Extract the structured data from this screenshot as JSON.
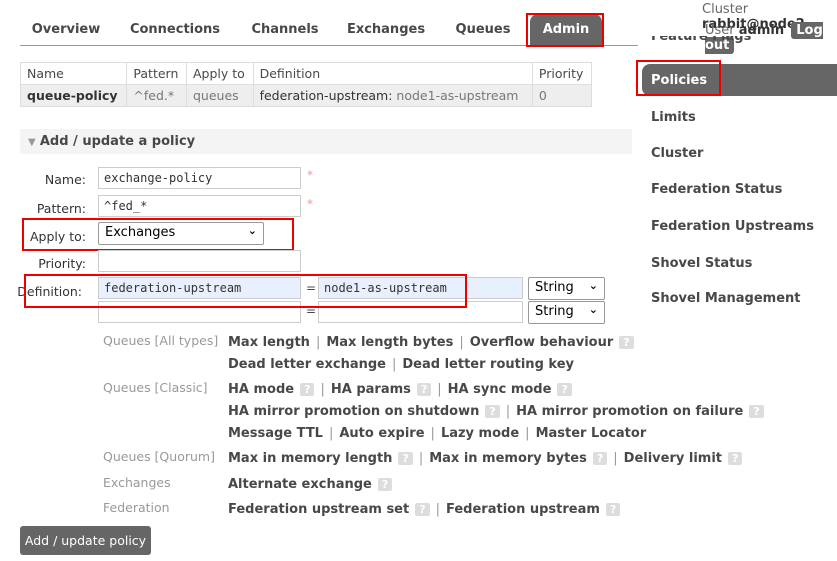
{
  "header": {
    "cluster_label": "Cluster",
    "cluster_name": "rabbit@node2",
    "user_label": "User",
    "user_name": "admin",
    "logout": "Log out"
  },
  "nav": {
    "tabs": [
      {
        "label": "Overview"
      },
      {
        "label": "Connections"
      },
      {
        "label": "Channels"
      },
      {
        "label": "Exchanges"
      },
      {
        "label": "Queues"
      },
      {
        "label": "Admin",
        "active": true
      }
    ]
  },
  "sidebar": {
    "items": [
      {
        "label": "Feature Flags"
      },
      {
        "label": "Policies",
        "active": true
      },
      {
        "label": "Limits"
      },
      {
        "label": "Cluster"
      },
      {
        "label": "Federation Status"
      },
      {
        "label": "Federation Upstreams"
      },
      {
        "label": "Shovel Status"
      },
      {
        "label": "Shovel Management"
      }
    ]
  },
  "policies_table": {
    "headers": [
      "Name",
      "Pattern",
      "Apply to",
      "Definition",
      "Priority"
    ],
    "rows": [
      {
        "name": "queue-policy",
        "pattern": "^fed.*",
        "apply_to": "queues",
        "def_key": "federation-upstream:",
        "def_value": "node1-as-upstream",
        "priority": "0"
      }
    ]
  },
  "form": {
    "section_title": "Add / update a policy",
    "name_label": "Name:",
    "name_value": "exchange-policy",
    "pattern_label": "Pattern:",
    "pattern_value": "^fed_*",
    "apply_label": "Apply to:",
    "apply_value": "Exchanges",
    "priority_label": "Priority:",
    "priority_value": "",
    "definition_label": "Definition:",
    "def_rows": [
      {
        "key": "federation-upstream",
        "eq": "=",
        "value": "node1-as-upstream",
        "type": "String"
      },
      {
        "key": "",
        "eq": "=",
        "value": "",
        "type": "String"
      }
    ],
    "required": "*",
    "submit": "Add / update policy"
  },
  "help": {
    "qmark": "?",
    "groups": [
      {
        "label": "Queues [All types]",
        "lines": [
          [
            {
              "t": "Max length"
            },
            {
              "t": "Max length bytes"
            },
            {
              "t": "Overflow behaviour",
              "h": true
            }
          ],
          [
            {
              "t": "Dead letter exchange"
            },
            {
              "t": "Dead letter routing key"
            }
          ]
        ]
      },
      {
        "label": "Queues [Classic]",
        "lines": [
          [
            {
              "t": "HA mode",
              "h": true
            },
            {
              "t": "HA params",
              "h": true
            },
            {
              "t": "HA sync mode",
              "h": true
            }
          ],
          [
            {
              "t": "HA mirror promotion on shutdown",
              "h": true
            },
            {
              "t": "HA mirror promotion on failure",
              "h": true
            }
          ],
          [
            {
              "t": "Message TTL"
            },
            {
              "t": "Auto expire"
            },
            {
              "t": "Lazy mode"
            },
            {
              "t": "Master Locator"
            }
          ]
        ]
      },
      {
        "label": "Queues [Quorum]",
        "lines": [
          [
            {
              "t": "Max in memory length",
              "h": true
            },
            {
              "t": "Max in memory bytes",
              "h": true
            },
            {
              "t": "Delivery limit",
              "h": true
            }
          ]
        ]
      },
      {
        "label": "Exchanges",
        "lines": [
          [
            {
              "t": "Alternate exchange",
              "h": true
            }
          ]
        ]
      },
      {
        "label": "Federation",
        "lines": [
          [
            {
              "t": "Federation upstream set",
              "h": true
            },
            {
              "t": "Federation upstream",
              "h": true
            }
          ]
        ]
      }
    ]
  }
}
